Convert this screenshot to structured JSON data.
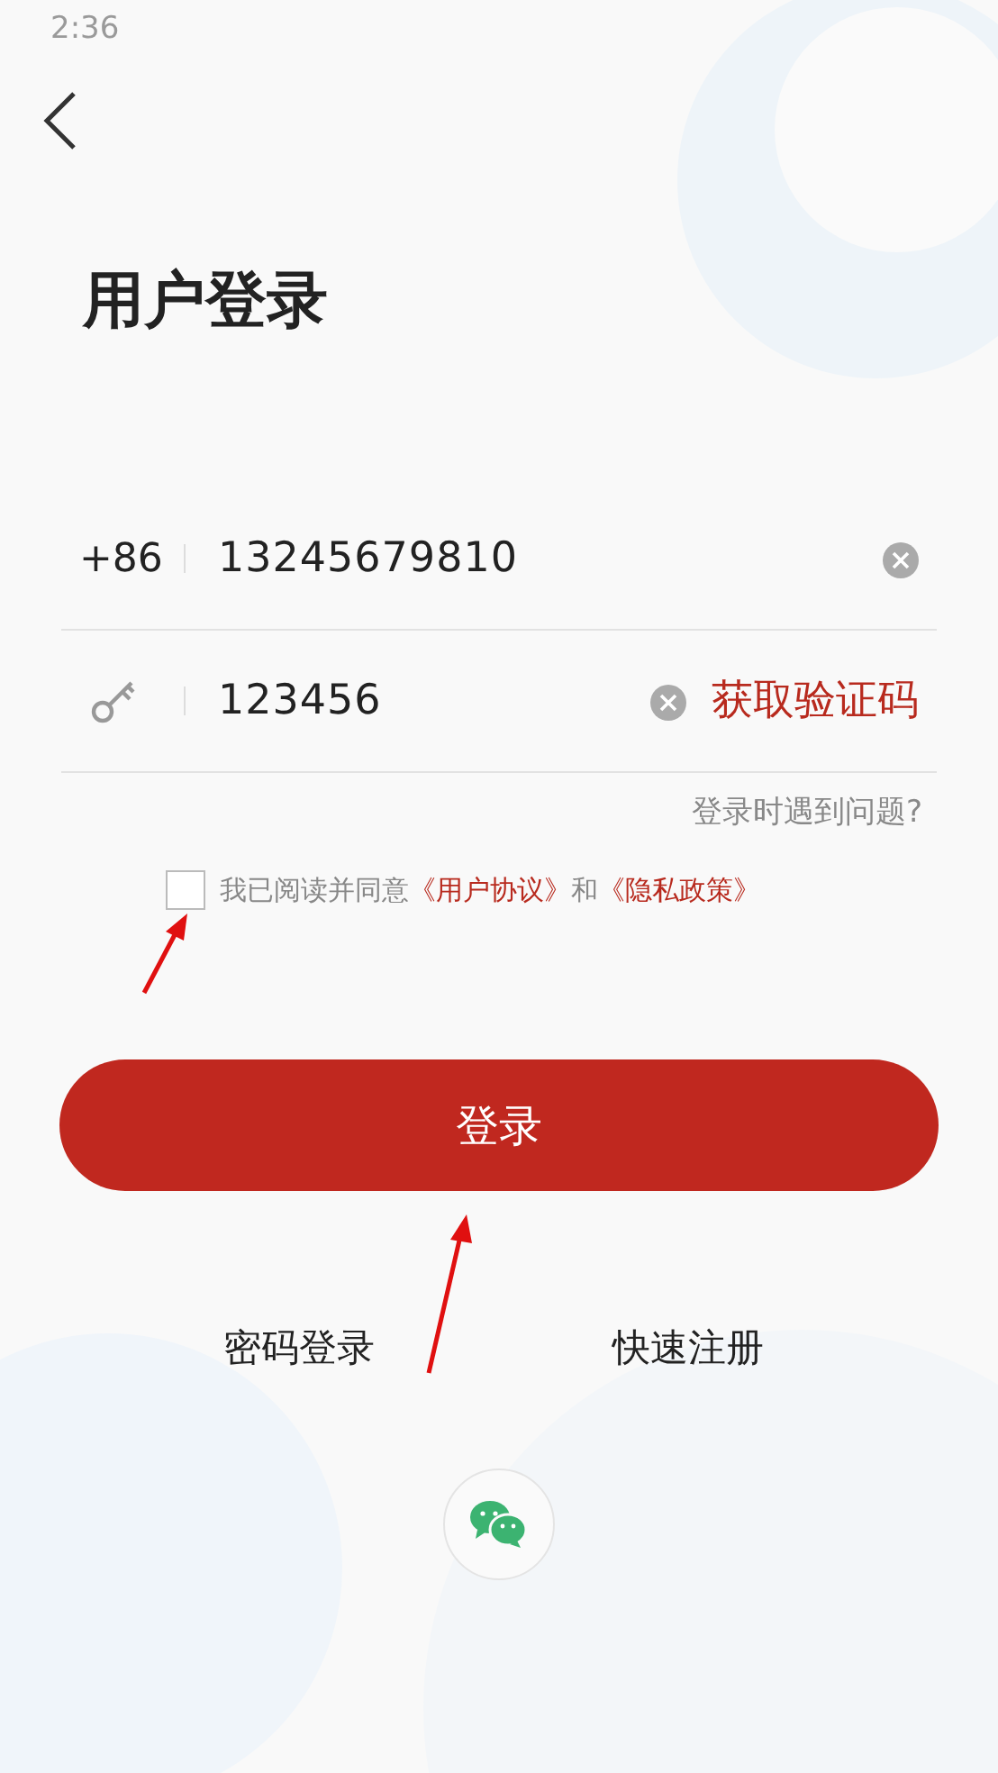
{
  "status_bar": {
    "time": "2:36"
  },
  "title": "用户登录",
  "phone": {
    "prefix": "+86",
    "value": "13245679810"
  },
  "code": {
    "value": "123456",
    "send_button": "获取验证码"
  },
  "trouble_link": "登录时遇到问题?",
  "agreement": {
    "checked": false,
    "text": "我已阅读并同意",
    "link_1": "《用户协议》",
    "joiner": "和",
    "link_2": "《隐私政策》"
  },
  "login_button": "登录",
  "alt_links": [
    "密码登录",
    "快速注册"
  ]
}
